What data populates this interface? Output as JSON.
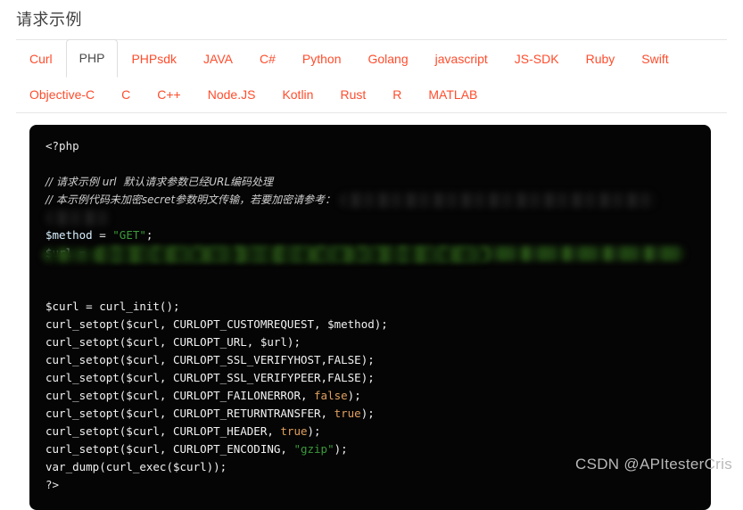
{
  "page": {
    "title": "请求示例"
  },
  "tabs": {
    "active": "PHP",
    "row1": [
      {
        "label": "Curl"
      },
      {
        "label": "PHP"
      },
      {
        "label": "PHPsdk"
      },
      {
        "label": "JAVA"
      },
      {
        "label": "C#"
      },
      {
        "label": "Python"
      },
      {
        "label": "Golang"
      },
      {
        "label": "javascript"
      },
      {
        "label": "JS-SDK"
      },
      {
        "label": "Ruby"
      },
      {
        "label": "Swift"
      }
    ],
    "row2": [
      {
        "label": "Objective-C"
      },
      {
        "label": "C"
      },
      {
        "label": "C++"
      },
      {
        "label": "Node.JS"
      },
      {
        "label": "Kotlin"
      },
      {
        "label": "Rust"
      },
      {
        "label": "R"
      },
      {
        "label": "MATLAB"
      }
    ]
  },
  "code": {
    "language": "php",
    "lines": {
      "open_tag": "<?php",
      "comment1": "// 请求示例 url  默认请求参数已经URL编码处理",
      "comment2_prefix": "// 本示例代码未加密secret参数明文传输，若要加密请参考：",
      "method_var": "$method",
      "method_eq": " = ",
      "method_value": "\"GET\"",
      "method_end": ";",
      "url_var": "$url",
      "url_eq": " = ",
      "curl_init": "$curl = curl_init();",
      "setopt_customrequest": "curl_setopt($curl, CURLOPT_CUSTOMREQUEST, $method);",
      "setopt_url": "curl_setopt($curl, CURLOPT_URL, $url);",
      "setopt_verifyhost": "curl_setopt($curl, CURLOPT_SSL_VERIFYHOST,FALSE);",
      "setopt_verifypeer": "curl_setopt($curl, CURLOPT_SSL_VERIFYPEER,FALSE);",
      "setopt_failonerror_a": "curl_setopt($curl, CURLOPT_FAILONERROR, ",
      "setopt_failonerror_b": "false",
      "setopt_failonerror_c": ");",
      "setopt_returntransfer_a": "curl_setopt($curl, CURLOPT_RETURNTRANSFER, ",
      "setopt_returntransfer_b": "true",
      "setopt_returntransfer_c": ");",
      "setopt_header_a": "curl_setopt($curl, CURLOPT_HEADER, ",
      "setopt_header_b": "true",
      "setopt_header_c": ");",
      "setopt_encoding_a": "curl_setopt($curl, CURLOPT_ENCODING, ",
      "setopt_encoding_b": "\"gzip\"",
      "setopt_encoding_c": ");",
      "var_dump": "var_dump(curl_exec($curl));",
      "close_tag": "?>"
    }
  },
  "watermark": {
    "text": "CSDN @APItesterCris"
  },
  "colors": {
    "accent": "#ff4d2d",
    "title": "#404040",
    "code_bg": "#050505",
    "string": "#3a9a3a",
    "constant": "#e0a060",
    "rule": "#e6e6e6"
  }
}
